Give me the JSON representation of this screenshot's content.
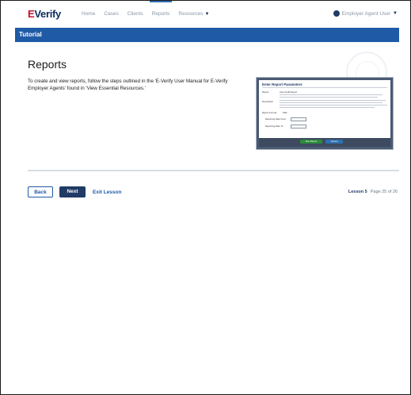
{
  "header": {
    "logo_prefix": "E",
    "logo_text": "Verify",
    "nav": [
      {
        "label": "Home"
      },
      {
        "label": "Cases"
      },
      {
        "label": "Clients"
      },
      {
        "label": "Reports"
      },
      {
        "label": "Resources"
      }
    ],
    "user_label": "Employer Agent User"
  },
  "tutorial_label": "Tutorial",
  "page": {
    "title": "Reports",
    "intro": "To create and view reports, follow the steps outlined in the 'E-Verify User Manual for E-Verify Employer Agents' found in 'View Essential Resources.'"
  },
  "screenshot": {
    "title": "Enter Report Parameters",
    "row_report": "Report",
    "report_value": "User Audit Report",
    "row_description": "Description",
    "row_format": "Report Format",
    "format_value": "PDF",
    "date_from": "Reporting Date From",
    "date_to": "Reporting Date To",
    "run_label": "Run Report",
    "cancel_label": "Cancel"
  },
  "footer": {
    "back_label": "Back",
    "next_label": "Next",
    "exit_label": "Exit Lesson",
    "lesson_label": "Lesson 5",
    "page_label": "Page 25 of 26"
  },
  "colors": {
    "primary": "#1e5aa6",
    "navy": "#1f3b66",
    "logo_red": "#c8102e"
  }
}
